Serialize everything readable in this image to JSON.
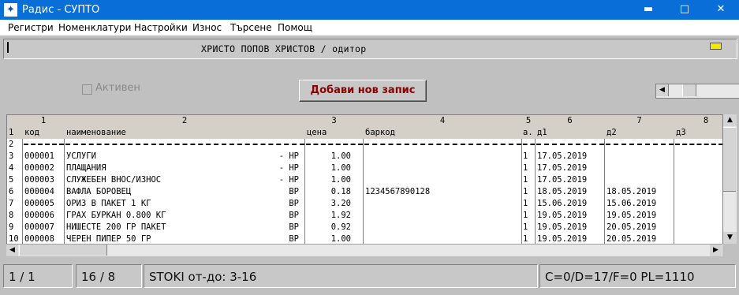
{
  "window": {
    "title": "Радис - СУПТО",
    "app_icon": "compass-icon",
    "minimize": "▬",
    "maximize": "□",
    "close": "✕"
  },
  "menu": [
    {
      "label": "Регистри"
    },
    {
      "label": "Номенклатури"
    },
    {
      "label": "Настройки"
    },
    {
      "label": "Износ"
    },
    {
      "label": "Търсене"
    },
    {
      "label": "Помощ"
    }
  ],
  "header": {
    "user_line": "ХРИСТО ПОПОВ ХРИСТОВ / одитор"
  },
  "controls": {
    "active_label": "Активен",
    "active_checked": false,
    "add_button": "Добави нов запис"
  },
  "grid": {
    "col_numbers": [
      "1",
      "2",
      "3",
      "4",
      "5",
      "6",
      "7",
      "8"
    ],
    "col_names": [
      "код",
      "наименование",
      "цена",
      "баркод",
      "а.",
      "д1",
      "д2",
      "д3"
    ],
    "row_numbers": [
      "1",
      "2",
      "3",
      "4",
      "5",
      "6",
      "7",
      "8",
      "9",
      "10"
    ],
    "rows": [
      {
        "code": "000001",
        "name": "УСЛУГИ",
        "vat": "- НР",
        "price": "1.00",
        "barcode": "",
        "a": "1",
        "d1": "17.05.2019",
        "d2": "",
        "d3": ""
      },
      {
        "code": "000002",
        "name": "ПЛАЩАНИЯ",
        "vat": "- НР",
        "price": "1.00",
        "barcode": "",
        "a": "1",
        "d1": "17.05.2019",
        "d2": "",
        "d3": ""
      },
      {
        "code": "000003",
        "name": "СЛУЖЕБЕН ВНОС/ИЗНОС",
        "vat": "- НР",
        "price": "1.00",
        "barcode": "",
        "a": "1",
        "d1": "17.05.2019",
        "d2": "",
        "d3": ""
      },
      {
        "code": "000004",
        "name": "ВАФЛА БОРОВЕЦ",
        "vat": "ВР",
        "price": "0.18",
        "barcode": "1234567890128",
        "a": "1",
        "d1": "18.05.2019",
        "d2": "18.05.2019",
        "d3": ""
      },
      {
        "code": "000005",
        "name": "ОРИЗ В ПАКЕТ 1 КГ",
        "vat": "ВР",
        "price": "3.20",
        "barcode": "",
        "a": "1",
        "d1": "15.06.2019",
        "d2": "15.06.2019",
        "d3": ""
      },
      {
        "code": "000006",
        "name": "ГРАХ БУРКАН 0.800 КГ",
        "vat": "ВР",
        "price": "1.92",
        "barcode": "",
        "a": "1",
        "d1": "19.05.2019",
        "d2": "19.05.2019",
        "d3": ""
      },
      {
        "code": "000007",
        "name": "НИШЕСТЕ 200 ГР ПАКЕТ",
        "vat": "ВР",
        "price": "0.92",
        "barcode": "",
        "a": "1",
        "d1": "19.05.2019",
        "d2": "20.05.2019",
        "d3": ""
      },
      {
        "code": "000008",
        "name": "ЧЕРЕН ПИПЕР 50 ГР",
        "vat": "ВР",
        "price": "1.00",
        "barcode": "",
        "a": "1",
        "d1": "19.05.2019",
        "d2": "20.05.2019",
        "d3": ""
      }
    ]
  },
  "status": {
    "page": "1 / 1",
    "records": "16 / 8",
    "range": "STOKI от-до: 3-16",
    "counters": "C=0/D=17/F=0 PL=1110"
  }
}
